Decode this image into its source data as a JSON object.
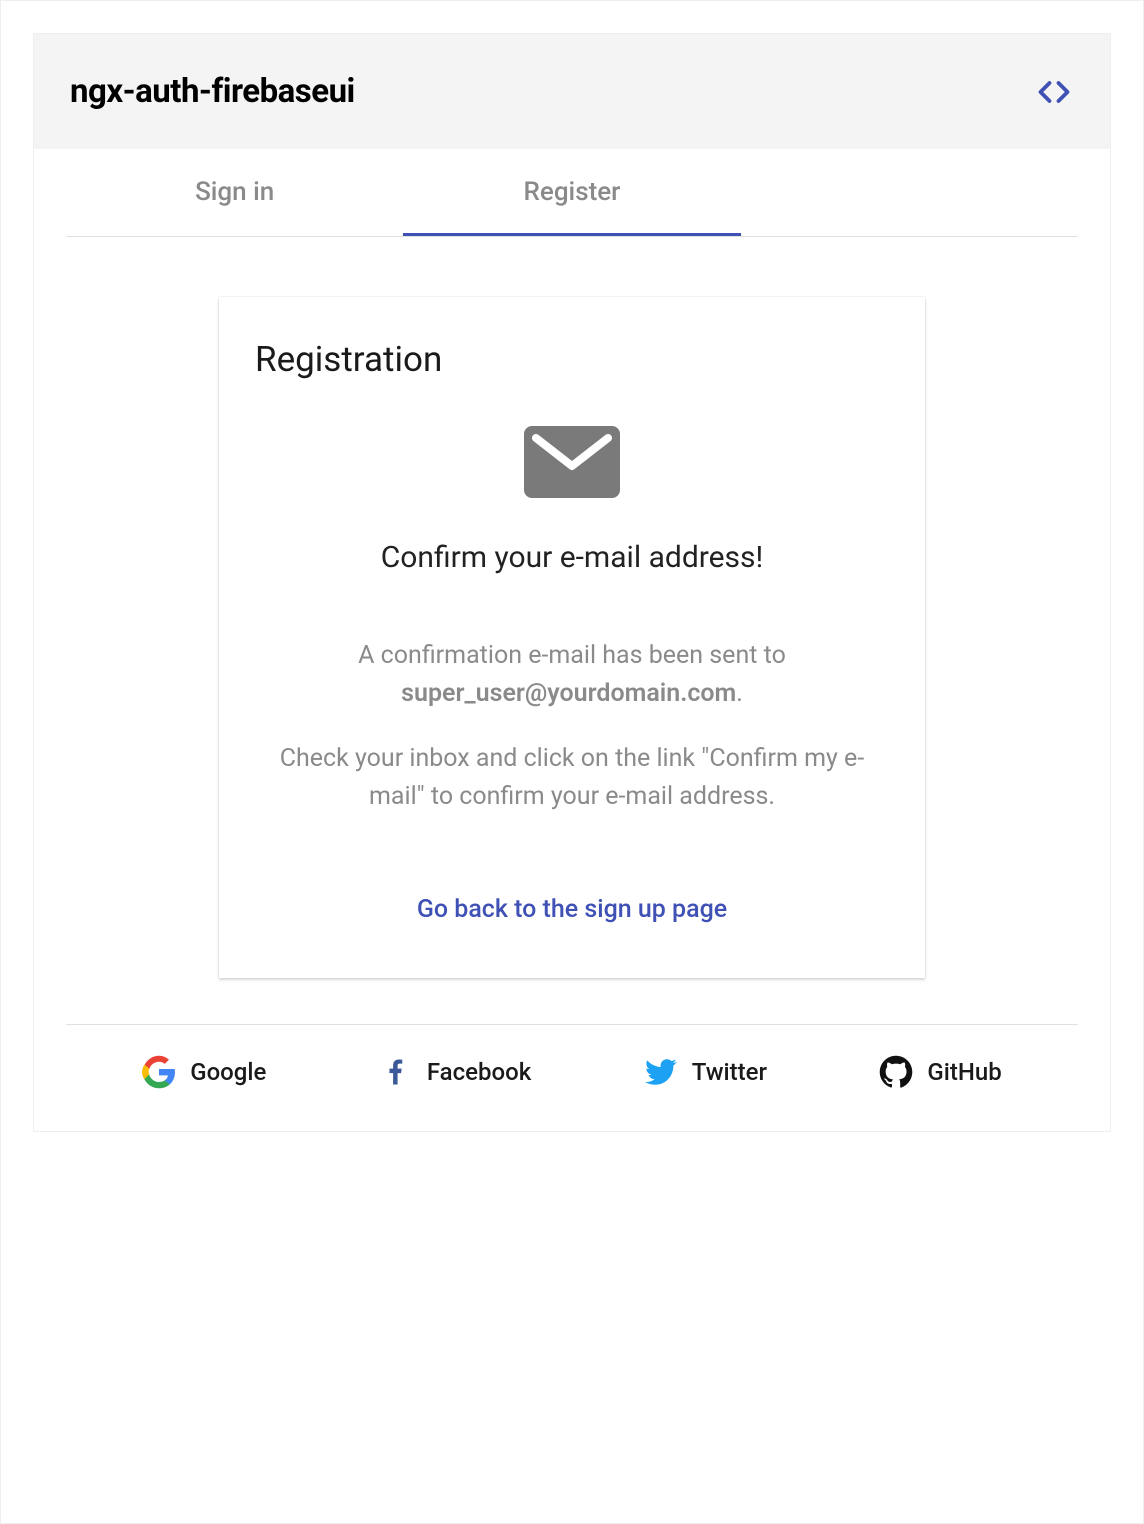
{
  "header": {
    "title": "ngx-auth-firebaseui"
  },
  "tabs": {
    "signin": "Sign in",
    "register": "Register"
  },
  "card": {
    "title": "Registration",
    "confirm_heading": "Confirm your e-mail address!",
    "sent_prefix": "A confirmation e-mail has been sent to",
    "email": "super_user@yourdomain.com",
    "period": ".",
    "instructions": "Check your inbox and click on the link \"Confirm my e-mail\" to confirm your e-mail address.",
    "back_link": "Go back to the sign up page"
  },
  "providers": {
    "google": "Google",
    "facebook": "Facebook",
    "twitter": "Twitter",
    "github": "GitHub"
  }
}
